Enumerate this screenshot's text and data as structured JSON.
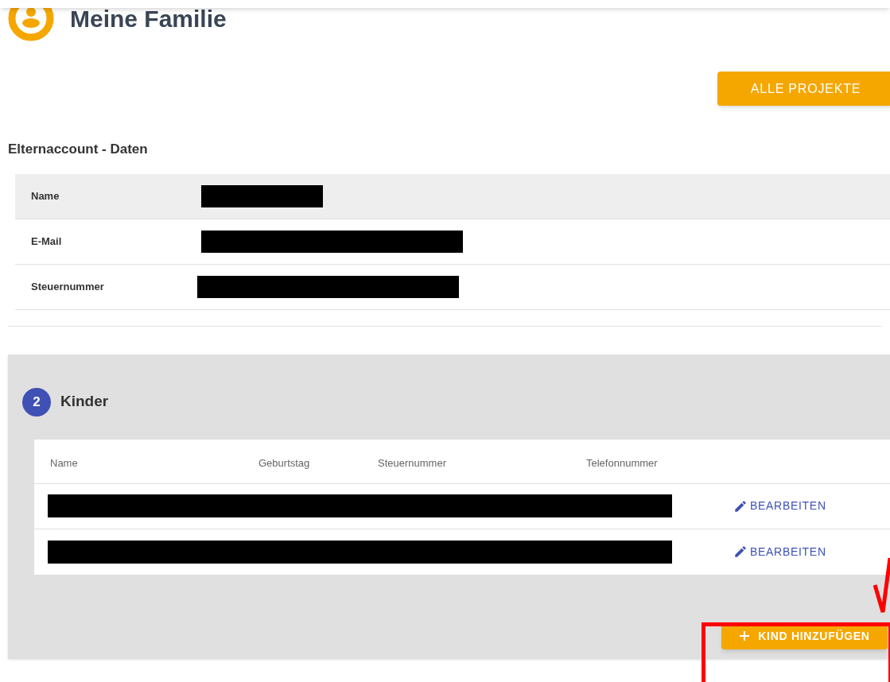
{
  "header": {
    "title": "Meine Familie"
  },
  "all_projects_button": "ALLE PROJEKTE",
  "parent_account": {
    "heading": "Elternaccount - Daten",
    "rows": [
      {
        "label": "Name",
        "redacted": true
      },
      {
        "label": "E-Mail",
        "redacted": true
      },
      {
        "label": "Steuernummer",
        "redacted": true
      }
    ]
  },
  "children": {
    "count": "2",
    "heading": "Kinder",
    "columns": [
      "Name",
      "Geburtstag",
      "Steuernummer",
      "Telefonnummer"
    ],
    "rows": [
      {
        "redacted": true,
        "edit": "BEARBEITEN"
      },
      {
        "redacted": true,
        "edit": "BEARBEITEN"
      }
    ],
    "add_button": "KIND HINZUFÜGEN"
  }
}
